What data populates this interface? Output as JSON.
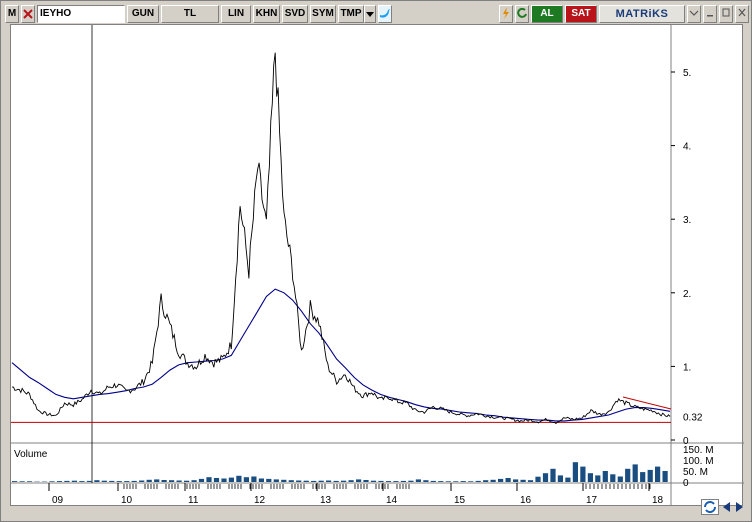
{
  "toolbar": {
    "menu_label": "M",
    "symbol": "IEYHO",
    "period": "GUN",
    "currency": "TL",
    "scale": "LIN",
    "khn": "KHN",
    "svd": "SVD",
    "sym": "SYM",
    "tmp": "TMP",
    "buy_label": "AL",
    "sell_label": "SAT",
    "brand": "MATRiKS",
    "icons": [
      "menu-icon",
      "tools-icon",
      "dropdown-icon",
      "twitter-icon",
      "lightning-icon",
      "refresh-icon",
      "chevron-down-icon",
      "minimize-icon",
      "maximize-icon",
      "close-icon"
    ]
  },
  "chart_data": [
    {
      "type": "line",
      "series": [
        {
          "values": [
            0.72,
            0.68,
            0.62,
            0.4,
            0.35,
            0.33,
            0.5,
            0.48,
            0.55,
            0.68,
            0.62,
            0.72,
            0.75,
            0.66,
            0.7,
            0.8,
            1.05,
            1.9,
            1.55,
            1.2,
            1.05,
            1.0,
            1.15,
            1.05,
            1.1,
            1.3,
            3.2,
            2.3,
            3.7,
            2.9,
            5.3,
            3.0,
            2.3,
            1.2,
            1.8,
            1.6,
            1.0,
            0.8,
            0.9,
            0.7,
            0.6,
            0.65,
            0.55,
            0.58,
            0.52,
            0.5,
            0.4,
            0.38,
            0.45,
            0.42,
            0.38,
            0.35,
            0.33,
            0.36,
            0.33,
            0.31,
            0.3,
            0.28,
            0.26,
            0.27,
            0.25,
            0.28,
            0.24,
            0.3,
            0.28,
            0.3,
            0.4,
            0.35,
            0.38,
            0.55,
            0.5,
            0.45,
            0.42,
            0.4,
            0.35,
            0.32
          ]
        },
        {
          "values": [
            1.05,
            0.95,
            0.85,
            0.78,
            0.7,
            0.62,
            0.58,
            0.56,
            0.58,
            0.6,
            0.62,
            0.63,
            0.65,
            0.67,
            0.7,
            0.72,
            0.76,
            0.85,
            0.95,
            1.02,
            1.05,
            1.06,
            1.07,
            1.08,
            1.1,
            1.15,
            1.35,
            1.55,
            1.75,
            1.95,
            2.05,
            2.0,
            1.9,
            1.75,
            1.58,
            1.45,
            1.28,
            1.1,
            0.98,
            0.85,
            0.75,
            0.68,
            0.62,
            0.58,
            0.55,
            0.52,
            0.48,
            0.45,
            0.43,
            0.42,
            0.4,
            0.38,
            0.37,
            0.36,
            0.34,
            0.33,
            0.31,
            0.3,
            0.29,
            0.28,
            0.27,
            0.27,
            0.26,
            0.26,
            0.27,
            0.28,
            0.3,
            0.32,
            0.34,
            0.38,
            0.42,
            0.44,
            0.44,
            0.43,
            0.41,
            0.39
          ]
        }
      ],
      "x_ticks": [
        "09",
        "10",
        "11",
        "12",
        "13",
        "14",
        "15",
        "16",
        "17",
        "18"
      ],
      "y_ticks": [
        "5.",
        "4.",
        "3.",
        "2.",
        "1.",
        "0"
      ],
      "last_value": "0.32",
      "ylim": [
        0,
        5.6
      ],
      "horizontal_line": 0.24
    },
    {
      "type": "bar",
      "title": "Volume",
      "y_ticks": [
        "150. M",
        "100. M",
        "50. M",
        "0"
      ],
      "ylim": [
        0,
        150
      ],
      "values": [
        4,
        3,
        3,
        2,
        2,
        3,
        4,
        5,
        6,
        4,
        5,
        8,
        6,
        5,
        4,
        4,
        5,
        7,
        10,
        12,
        9,
        8,
        7,
        6,
        8,
        14,
        22,
        18,
        16,
        20,
        28,
        22,
        25,
        16,
        14,
        12,
        10,
        8,
        7,
        6,
        5,
        6,
        7,
        5,
        6,
        8,
        12,
        9,
        6,
        5,
        4,
        4,
        5,
        6,
        12,
        8,
        5,
        4,
        3,
        3,
        4,
        3,
        5,
        8,
        10,
        14,
        18,
        12,
        10,
        8,
        24,
        40,
        60,
        30,
        20,
        90,
        70,
        40,
        30,
        50,
        35,
        25,
        60,
        80,
        45,
        55,
        70,
        50
      ]
    }
  ]
}
